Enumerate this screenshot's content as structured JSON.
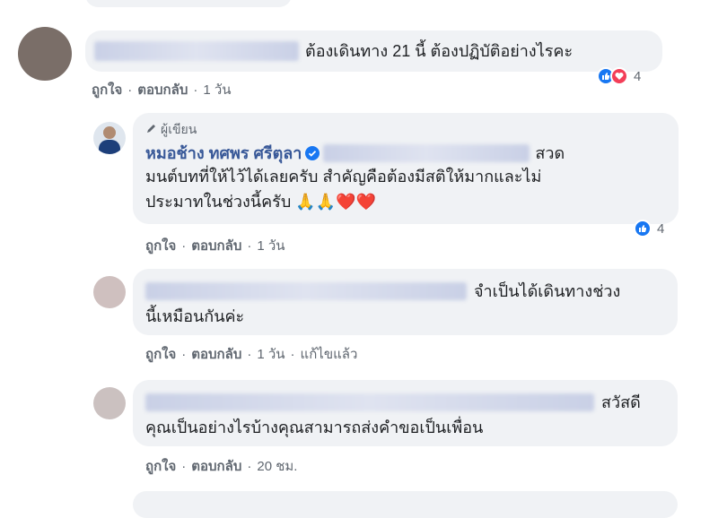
{
  "comments": [
    {
      "text": "ต้องเดินทาง 21 นี้ ต้องปฏิบัติอย่างไรคะ",
      "actions": {
        "like": "ถูกใจ",
        "reply": "ตอบกลับ",
        "time": "1 วัน"
      },
      "reaction_count": "4"
    },
    {
      "author_badge": "ผู้เขียน",
      "author_name": "หมอช้าง ทศพร ศรีตุลา",
      "line1_tail": "สวด",
      "line2": "มนต์บทที่ให้ไว้ได้เลยครับ สำคัญคือต้องมีสติให้มากและไม่",
      "line3": "ประมาทในช่วงนี้ครับ 🙏🙏❤️❤️",
      "actions": {
        "like": "ถูกใจ",
        "reply": "ตอบกลับ",
        "time": "1 วัน"
      },
      "reaction_count": "4"
    },
    {
      "line1_tail": "จำเป็นได้เดินทางช่วง",
      "line2": "นี้เหมือนกันค่ะ",
      "actions": {
        "like": "ถูกใจ",
        "reply": "ตอบกลับ",
        "time": "1 วัน",
        "edited": "แก้ไขแล้ว"
      }
    },
    {
      "line1_tail": "สวัสดี",
      "line2": "คุณเป็นอย่างไรบ้างคุณสามารถส่งคำขอเป็นเพื่อน",
      "actions": {
        "like": "ถูกใจ",
        "reply": "ตอบกลับ",
        "time": "20 ชม."
      }
    }
  ],
  "icons": [
    "pencil-icon",
    "verified-icon",
    "like-reaction-icon",
    "love-reaction-icon"
  ],
  "colors": {
    "link": "#385898",
    "bubble": "#f0f2f5",
    "like": "#1877f2",
    "love": "#f33e58",
    "verified": "#1877f2"
  }
}
